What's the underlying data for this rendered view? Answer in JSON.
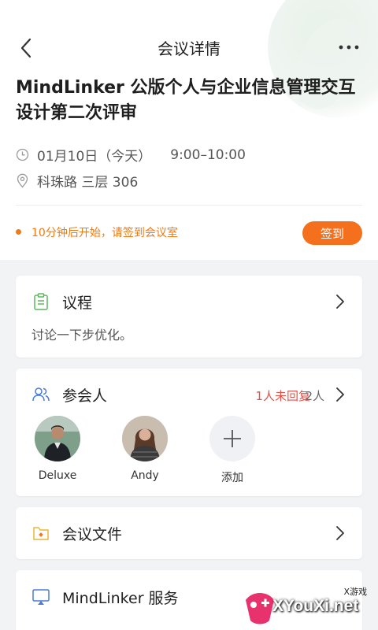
{
  "nav": {
    "title": "会议详情"
  },
  "meeting": {
    "title": "MindLinker 公版个人与企业信息管理交互设计第二次评审",
    "date": "01月10日（今天）",
    "time": "9:00–10:00",
    "location": "科珠路 三层 306"
  },
  "notice": {
    "text": "10分钟后开始，请签到会议室",
    "checkin_label": "签到"
  },
  "agenda": {
    "label": "议程",
    "text": "讨论一下步优化。"
  },
  "participants": {
    "label": "参会人",
    "unreplied": "1人未回复",
    "count": "2人",
    "people": [
      {
        "name": "Deluxe"
      },
      {
        "name": "Andy"
      }
    ],
    "add_label": "添加"
  },
  "files": {
    "label": "会议文件"
  },
  "service": {
    "label": "MindLinker 服务"
  },
  "watermark": {
    "text": "XYouXi.net",
    "small": "X游戏"
  },
  "colors": {
    "accent": "#f4701c",
    "warning_text": "#f07a14",
    "unreplied": "#e0524a",
    "icon_blue": "#4a7bd8",
    "icon_green": "#5cb85c",
    "icon_yellow": "#e8b53a"
  }
}
